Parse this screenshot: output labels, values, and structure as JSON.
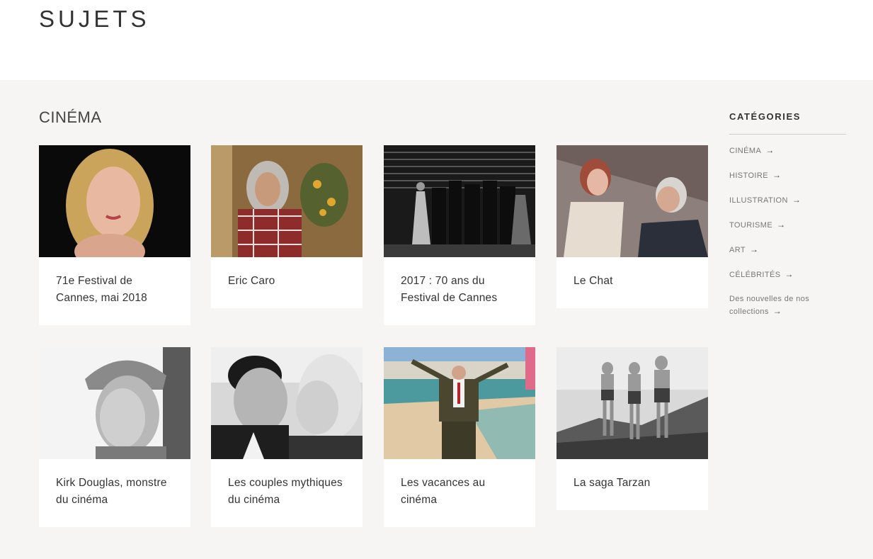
{
  "page": {
    "title": "SUJETS"
  },
  "section": {
    "title": "CINÉMA"
  },
  "cards": [
    {
      "title": "71e Festival de Cannes, mai 2018"
    },
    {
      "title": "Eric Caro"
    },
    {
      "title": "2017 : 70 ans du Festival de Cannes"
    },
    {
      "title": "Le Chat"
    },
    {
      "title": "Kirk Douglas, monstre du cinéma"
    },
    {
      "title": "Les couples mythiques du cinéma"
    },
    {
      "title": "Les vacances au cinéma"
    },
    {
      "title": "La saga Tarzan"
    }
  ],
  "sidebar": {
    "title": "CATÉGORIES",
    "items": [
      {
        "label": "CINÉMA"
      },
      {
        "label": "HISTOIRE"
      },
      {
        "label": "ILLUSTRATION"
      },
      {
        "label": "TOURISME"
      },
      {
        "label": "ART"
      },
      {
        "label": "CÉLÉBRITÉS"
      },
      {
        "label": "Des nouvelles de nos collections"
      }
    ],
    "arrow": "→"
  }
}
